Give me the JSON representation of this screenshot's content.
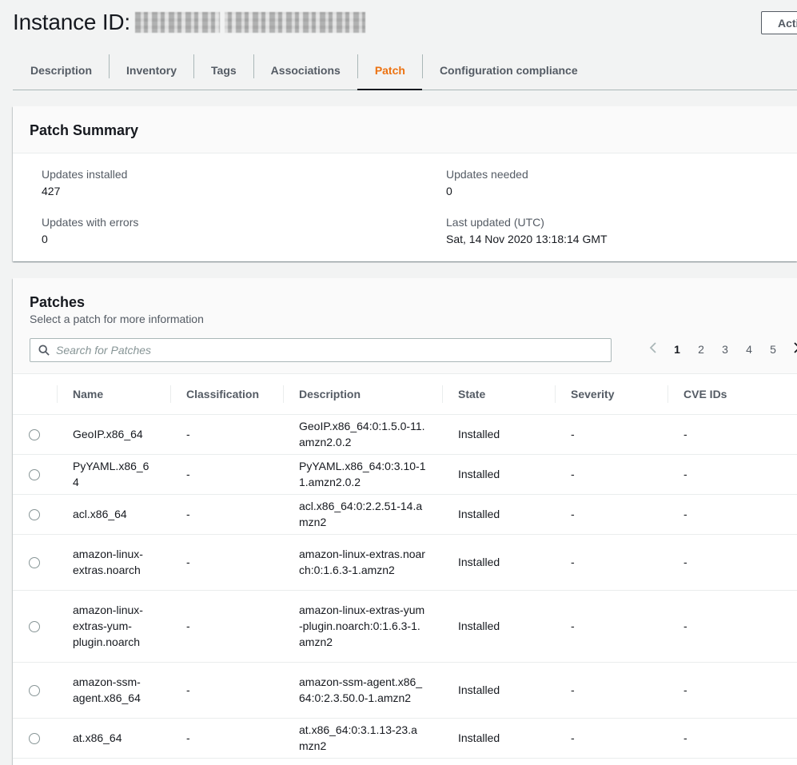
{
  "header": {
    "title": "Instance ID:",
    "actions_label": "Actions"
  },
  "tabs": [
    {
      "label": "Description"
    },
    {
      "label": "Inventory"
    },
    {
      "label": "Tags"
    },
    {
      "label": "Associations"
    },
    {
      "label": "Patch",
      "active": true
    },
    {
      "label": "Configuration compliance"
    }
  ],
  "summary": {
    "title": "Patch Summary",
    "updates_installed": {
      "label": "Updates installed",
      "value": "427"
    },
    "updates_needed": {
      "label": "Updates needed",
      "value": "0"
    },
    "updates_with_errors": {
      "label": "Updates with errors",
      "value": "0"
    },
    "last_updated": {
      "label": "Last updated (UTC)",
      "value": "Sat, 14 Nov 2020 13:18:14 GMT"
    }
  },
  "patches": {
    "title": "Patches",
    "subtitle": "Select a patch for more information",
    "search_placeholder": "Search for Patches",
    "pages": [
      "1",
      "2",
      "3",
      "4",
      "5"
    ],
    "current_page": "1",
    "columns": [
      "Name",
      "Classification",
      "Description",
      "State",
      "Severity",
      "CVE IDs"
    ],
    "rows": [
      {
        "name": "GeoIP.x86_64",
        "classification": "-",
        "description": "GeoIP.x86_64:0:1.5.0-11.amzn2.0.2",
        "state": "Installed",
        "severity": "-",
        "cve": "-"
      },
      {
        "name": "PyYAML.x86_64",
        "classification": "-",
        "description": "PyYAML.x86_64:0:3.10-11.amzn2.0.2",
        "state": "Installed",
        "severity": "-",
        "cve": "-"
      },
      {
        "name": "acl.x86_64",
        "classification": "-",
        "description": "acl.x86_64:0:2.2.51-14.amzn2",
        "state": "Installed",
        "severity": "-",
        "cve": "-"
      },
      {
        "name": "amazon-linux-extras.noarch",
        "classification": "-",
        "description": "amazon-linux-extras.noarch:0:1.6.3-1.amzn2",
        "state": "Installed",
        "severity": "-",
        "cve": "-"
      },
      {
        "name": "amazon-linux-extras-yum-plugin.noarch",
        "classification": "-",
        "description": "amazon-linux-extras-yum-plugin.noarch:0:1.6.3-1.amzn2",
        "state": "Installed",
        "severity": "-",
        "cve": "-"
      },
      {
        "name": "amazon-ssm-agent.x86_64",
        "classification": "-",
        "description": "amazon-ssm-agent.x86_64:0:2.3.50.0-1.amzn2",
        "state": "Installed",
        "severity": "-",
        "cve": "-"
      },
      {
        "name": "at.x86_64",
        "classification": "-",
        "description": "at.x86_64:0:3.1.13-23.amzn2",
        "state": "Installed",
        "severity": "-",
        "cve": "-"
      }
    ]
  }
}
